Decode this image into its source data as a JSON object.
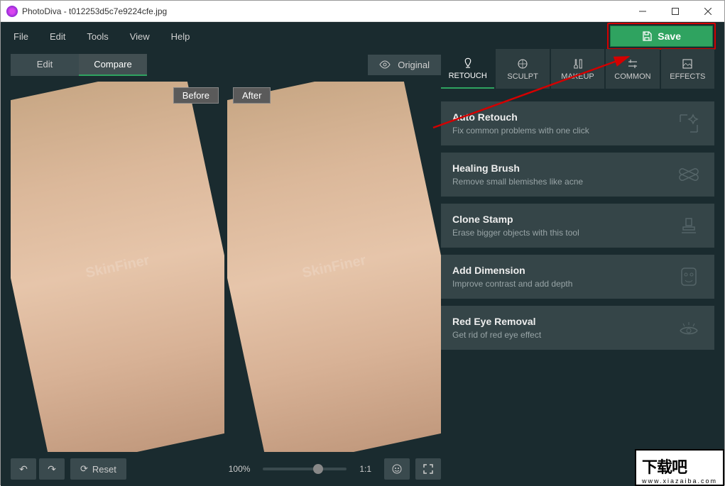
{
  "titlebar": {
    "app": "PhotoDiva",
    "file": "t012253d5c7e9224cfe.jpg"
  },
  "menubar": {
    "items": [
      "File",
      "Edit",
      "Tools",
      "View",
      "Help"
    ],
    "save": "Save"
  },
  "modes": {
    "edit": "Edit",
    "compare": "Compare",
    "original": "Original"
  },
  "labels": {
    "before": "Before",
    "after": "After"
  },
  "bottom": {
    "reset": "Reset",
    "zoom": "100%",
    "ratio": "1:1"
  },
  "toolTabs": [
    "RETOUCH",
    "SCULPT",
    "MAKEUP",
    "COMMON",
    "EFFECTS"
  ],
  "cards": [
    {
      "title": "Auto Retouch",
      "sub": "Fix common problems with one click"
    },
    {
      "title": "Healing Brush",
      "sub": "Remove small blemishes like acne"
    },
    {
      "title": "Clone Stamp",
      "sub": "Erase bigger objects with this tool"
    },
    {
      "title": "Add Dimension",
      "sub": "Improve contrast and add depth"
    },
    {
      "title": "Red Eye Removal",
      "sub": "Get rid of red eye effect"
    }
  ],
  "watermark": {
    "big": "下载吧",
    "small": "www.xiazaiba.com",
    "face": "SkinFiner"
  }
}
